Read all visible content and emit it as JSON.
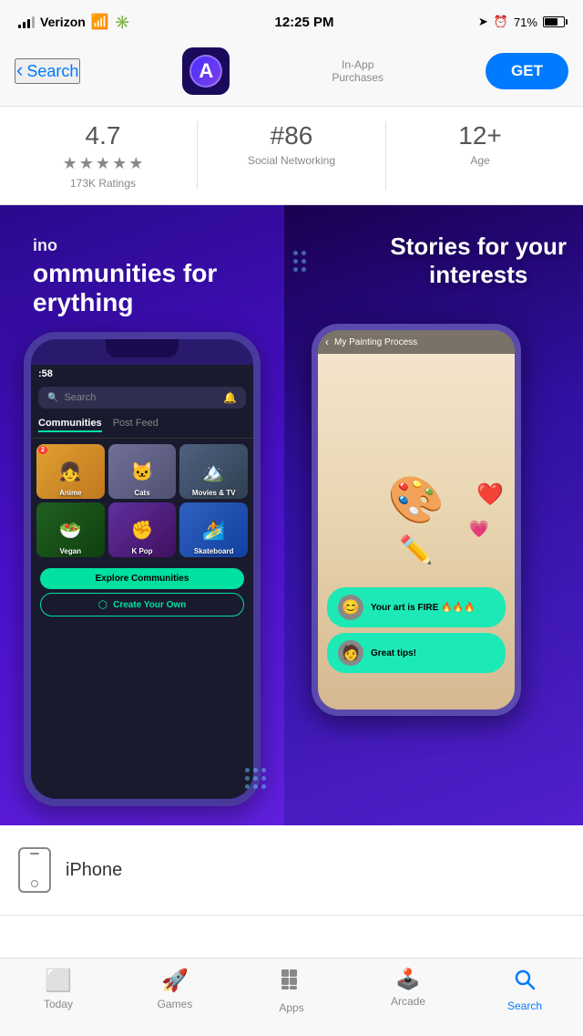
{
  "statusBar": {
    "carrier": "Verizon",
    "time": "12:25 PM",
    "battery": "71%"
  },
  "header": {
    "backLabel": "Search",
    "inAppText": "In-App\nPurchases",
    "getLabel": "GET"
  },
  "rating": {
    "score": "4.7",
    "ratingsCount": "173K Ratings",
    "rank": "#86",
    "category": "Social Networking",
    "age": "12+",
    "ageLabel": "Age"
  },
  "leftScreenshot": {
    "appName": "ino",
    "tagline": "ommunities for\nerything",
    "searchPlaceholder": "Search",
    "tabCommunities": "Communities",
    "tabPostFeed": "Post Feed",
    "communities": [
      {
        "label": "Anime",
        "emoji": "👧",
        "badge": "2",
        "bg": "#e8c060"
      },
      {
        "label": "Cats",
        "emoji": "🐱",
        "bg": "#8080a0"
      },
      {
        "label": "Movies & TV",
        "emoji": "🏔️",
        "bg": "#404060"
      },
      {
        "label": "Vegan",
        "emoji": "🥗",
        "bg": "#408040"
      },
      {
        "label": "K Pop",
        "emoji": "✊",
        "bg": "#603080"
      },
      {
        "label": "Skateboard",
        "emoji": "🏄",
        "bg": "#4080c0"
      }
    ],
    "exploreBtn": "Explore Communities",
    "createOwnBtn": "Create Your Own",
    "time": ":58"
  },
  "rightScreenshot": {
    "title": "Stories for your\ninterests",
    "videoTitle": "My Painting Process",
    "comment1": "Your art is FIRE 🔥🔥🔥",
    "comment2": "Great tips!"
  },
  "iphone": {
    "label": "iPhone"
  },
  "tabBar": {
    "tabs": [
      {
        "label": "Today",
        "icon": "⬜",
        "active": false
      },
      {
        "label": "Games",
        "icon": "🚀",
        "active": false
      },
      {
        "label": "Apps",
        "icon": "⬛",
        "active": false
      },
      {
        "label": "Arcade",
        "icon": "🕹️",
        "active": false
      },
      {
        "label": "Search",
        "icon": "🔍",
        "active": true
      }
    ]
  }
}
